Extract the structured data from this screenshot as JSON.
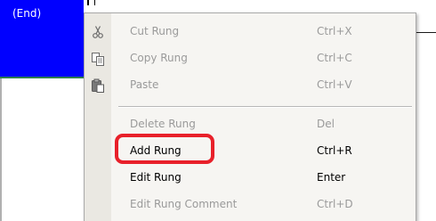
{
  "ladder": {
    "end_rung_label": "(End)"
  },
  "context_menu": {
    "items": [
      {
        "label": "Cut Rung",
        "shortcut": "Ctrl+X",
        "icon": "scissors-icon",
        "enabled": false
      },
      {
        "label": "Copy Rung",
        "shortcut": "Ctrl+C",
        "icon": "copy-icon",
        "enabled": false
      },
      {
        "label": "Paste",
        "shortcut": "Ctrl+V",
        "icon": "paste-icon",
        "enabled": false
      },
      {
        "label": "Delete Rung",
        "shortcut": "Del",
        "enabled": false
      },
      {
        "label": "Add Rung",
        "shortcut": "Ctrl+R",
        "enabled": true
      },
      {
        "label": "Edit Rung",
        "shortcut": "Enter",
        "enabled": true
      },
      {
        "label": "Edit Rung Comment",
        "shortcut": "Ctrl+D",
        "enabled": false
      }
    ]
  },
  "annotation": {
    "highlight_color": "#e8202a",
    "highlighted_item": "Add Rung"
  },
  "colors": {
    "rung_background": "#0000ff",
    "menu_background": "#f6f5f2",
    "disabled_text": "#9a9a9a"
  }
}
